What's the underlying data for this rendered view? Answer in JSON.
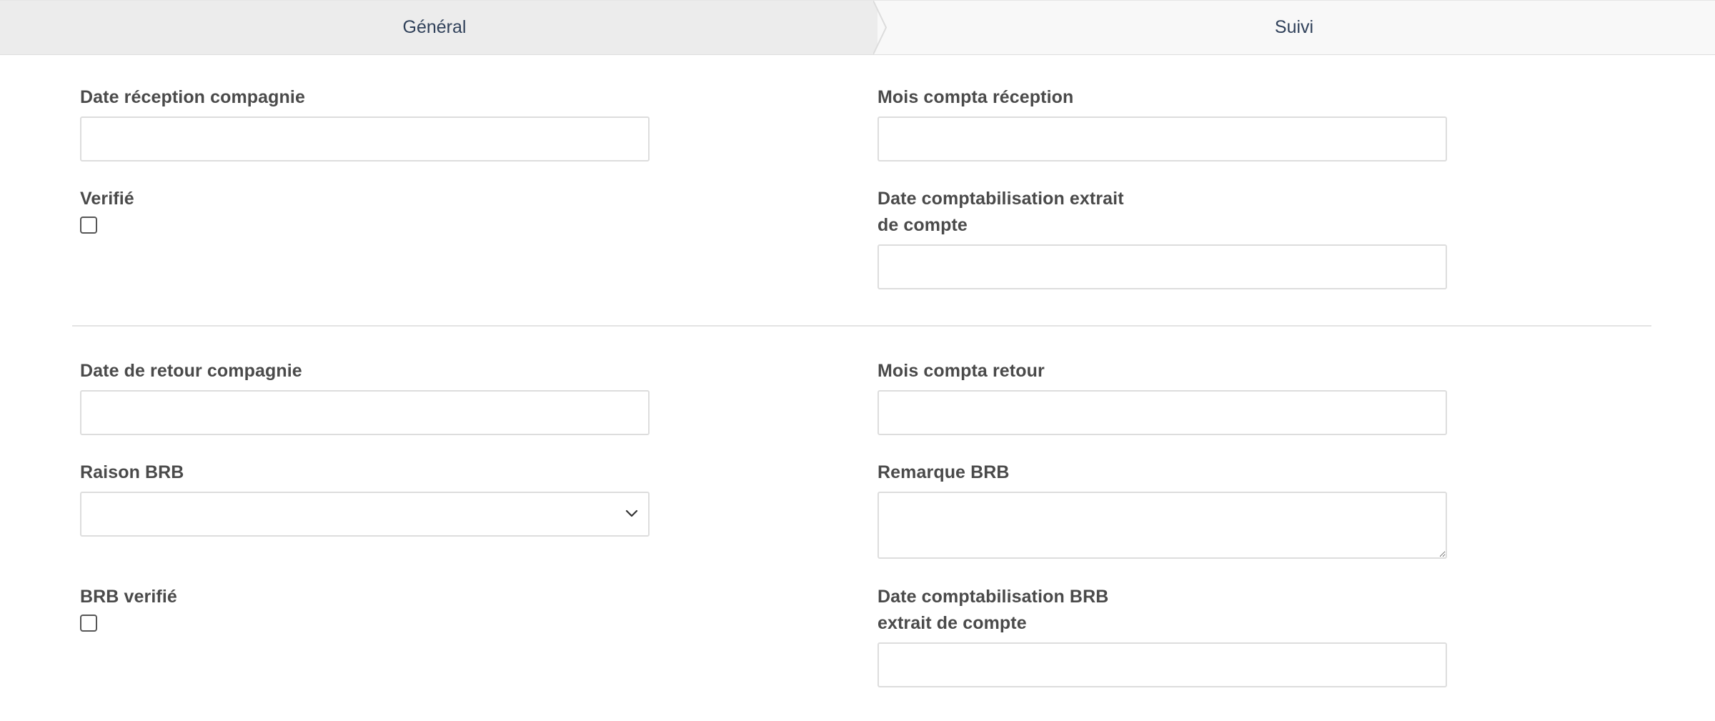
{
  "tabs": {
    "general": "Général",
    "suivi": "Suivi"
  },
  "section1": {
    "date_reception_compagnie": {
      "label": "Date réception compagnie",
      "value": ""
    },
    "mois_compta_reception": {
      "label": "Mois compta réception",
      "value": ""
    },
    "verifie": {
      "label": "Verifié",
      "checked": false
    },
    "date_comptabilisation_extrait": {
      "label_line1": "Date comptabilisation extrait",
      "label_line2": "de compte",
      "value": ""
    }
  },
  "section2": {
    "date_retour_compagnie": {
      "label": "Date de retour compagnie",
      "value": ""
    },
    "mois_compta_retour": {
      "label": "Mois compta retour",
      "value": ""
    },
    "raison_brb": {
      "label": "Raison BRB",
      "selected": ""
    },
    "remarque_brb": {
      "label": "Remarque BRB",
      "value": ""
    },
    "brb_verifie": {
      "label": "BRB verifié",
      "checked": false
    },
    "date_comptabilisation_brb": {
      "label_line1": "Date comptabilisation BRB",
      "label_line2": "extrait de compte",
      "value": ""
    }
  },
  "colors": {
    "tab_text": "#30415a",
    "active_tab_bg": "#ececec",
    "border": "#dddddd",
    "label": "#4a4a4a"
  },
  "icons": {
    "select_arrow": "chevron-down-icon",
    "resize_handle": "resize-handle-icon"
  }
}
